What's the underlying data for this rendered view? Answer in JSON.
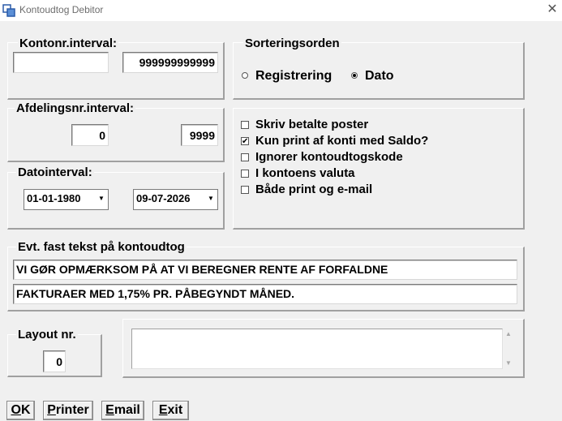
{
  "window": {
    "title": "Kontoudtog Debitor",
    "close_glyph": "✕"
  },
  "account_interval": {
    "label": "Kontonr.interval:",
    "from": "",
    "to": "999999999999"
  },
  "department_interval": {
    "label": "Afdelingsnr.interval:",
    "from": "0",
    "to": "9999"
  },
  "date_interval": {
    "label": "Datointerval:",
    "from": "01-01-1980",
    "to": "09-07-2026"
  },
  "sort_order": {
    "label": "Sorteringsorden",
    "options": [
      {
        "label": "Registrering",
        "selected": false
      },
      {
        "label": "Dato",
        "selected": true
      }
    ]
  },
  "options": [
    {
      "label": "Skriv betalte poster",
      "checked": false
    },
    {
      "label": "Kun print af konti med Saldo?",
      "checked": true
    },
    {
      "label": "Ignorer kontoudtogskode",
      "checked": false
    },
    {
      "label": "I kontoens valuta",
      "checked": false
    },
    {
      "label": "Både print og e-mail",
      "checked": false
    }
  ],
  "fixed_text": {
    "label": "Evt. fast tekst på kontoudtog",
    "line1": "VI GØR OPMÆRKSOM PÅ AT VI BEREGNER RENTE AF FORFALDNE",
    "line2": "FAKTURAER MED 1,75% PR. PÅBEGYNDT MÅNED."
  },
  "layout": {
    "label": "Layout nr.",
    "value": "0"
  },
  "memo": {
    "value": ""
  },
  "buttons": {
    "ok": {
      "hotkey": "O",
      "rest": "K"
    },
    "printer": {
      "hotkey": "P",
      "rest": "rinter"
    },
    "email": {
      "hotkey": "E",
      "rest": "mail"
    },
    "exit": {
      "hotkey": "E",
      "rest": "xit"
    }
  },
  "icons": {
    "app": "app-window-icon",
    "close": "close-icon",
    "dropdown": "chevron-down-icon",
    "check": "✔",
    "scroll_up": "▲",
    "scroll_down": "▼"
  }
}
